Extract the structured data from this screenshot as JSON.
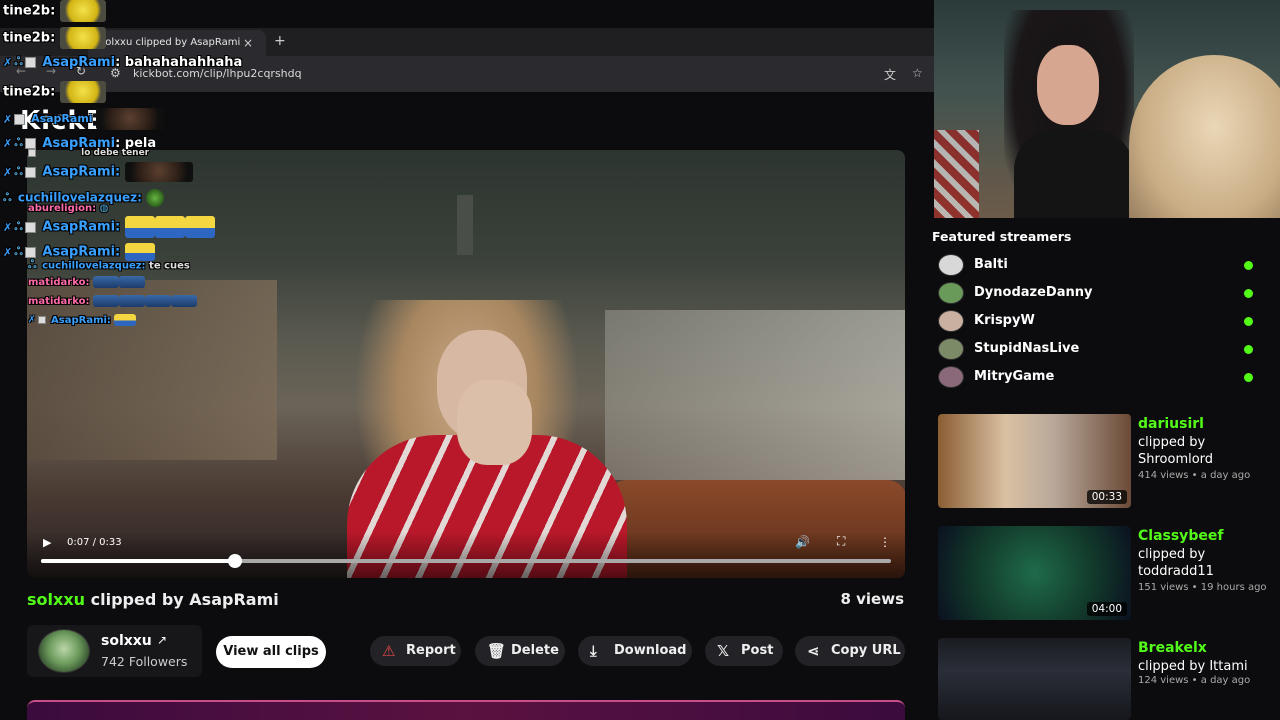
{
  "browser": {
    "tab_title": "solxxu clipped by AsapRami",
    "tab_close": "×",
    "tab_new": "+",
    "url": "kickbot.com/clip/lhpu2cqrshdq",
    "site_logo_partial": "KickB"
  },
  "chat": {
    "messages": [
      {
        "user": "tine2b:",
        "text": "",
        "user_color": "#ffffff"
      },
      {
        "user": "tine2b:",
        "text": "",
        "user_color": "#ffffff"
      },
      {
        "user": "AsapRami",
        "text": ": bahahahahhaha",
        "user_color": "#3aa0ff"
      },
      {
        "user": "tine2b:",
        "text": "",
        "user_color": "#ffffff"
      },
      {
        "user": "AsapRami",
        "text": "",
        "user_color": "#3aa0ff"
      },
      {
        "user": "AsapRami",
        "text": ": pela",
        "user_color": "#3aa0ff"
      },
      {
        "user": "AsapRami",
        "text": "lo debe tener",
        "user_color": "#3aa0ff"
      },
      {
        "user": "AsapRami:",
        "text": "",
        "user_color": "#3aa0ff"
      },
      {
        "user": "cuchillovelazquez:",
        "text": "",
        "user_color": "#3aa0ff"
      },
      {
        "user": "abureligion:",
        "text": "",
        "user_color": "#ff6aa8"
      },
      {
        "user": "AsapRami:",
        "text": "",
        "user_color": "#3aa0ff"
      },
      {
        "user": "cuchillovelazquez:",
        "text": "te cues",
        "user_color": "#3aa0ff"
      },
      {
        "user": "AsapRami:",
        "text": "",
        "user_color": "#3aa0ff"
      },
      {
        "user": "matidarko:",
        "text": "",
        "user_color": "#ff6aa8"
      },
      {
        "user": "matidarko:",
        "text": "",
        "user_color": "#ff6aa8"
      },
      {
        "user": "AsapRami:",
        "text": "",
        "user_color": "#3aa0ff"
      }
    ]
  },
  "player": {
    "current_time": "0:07",
    "duration": "0:33",
    "time_display": "0:07 / 0:33",
    "progress_fraction": 0.228
  },
  "clip": {
    "streamer": "solxxu",
    "clipped_by_text": "clipped by AsapRami",
    "views": "8 views"
  },
  "channel": {
    "name": "solxxu",
    "followers": "742 Followers",
    "view_all_label": "View all clips"
  },
  "actions": [
    {
      "label": "Report",
      "icon": "warning-icon"
    },
    {
      "label": "Delete",
      "icon": "trash-icon"
    },
    {
      "label": "Download",
      "icon": "download-icon"
    },
    {
      "label": "Post",
      "icon": "x-logo-icon"
    },
    {
      "label": "Copy URL",
      "icon": "share-icon"
    }
  ],
  "sidebar": {
    "featured_title": "Featured streamers",
    "streamers": [
      {
        "name": "Balti",
        "live": true
      },
      {
        "name": "DynodazeDanny",
        "live": true
      },
      {
        "name": "KrispyW",
        "live": true
      },
      {
        "name": "StupidNasLive",
        "live": true
      },
      {
        "name": "MitryGame",
        "live": true
      }
    ],
    "clips": [
      {
        "streamer": "dariusirl",
        "by_label": "clipped by",
        "by_user": "Shroomlord",
        "meta": "414 views • a day ago",
        "duration": "00:33"
      },
      {
        "streamer": "Classybeef",
        "by_label": "clipped by",
        "by_user": "toddradd11",
        "meta": "151 views • 19 hours ago",
        "duration": "04:00"
      },
      {
        "streamer": "Breakelx",
        "by_label": "clipped by Ittami",
        "by_user": "",
        "meta": "124 views • a day ago",
        "duration": ""
      }
    ]
  },
  "colors": {
    "accent_green": "#53fc18",
    "chat_blue": "#3aa0ff",
    "chat_pink": "#ff6aa8"
  }
}
